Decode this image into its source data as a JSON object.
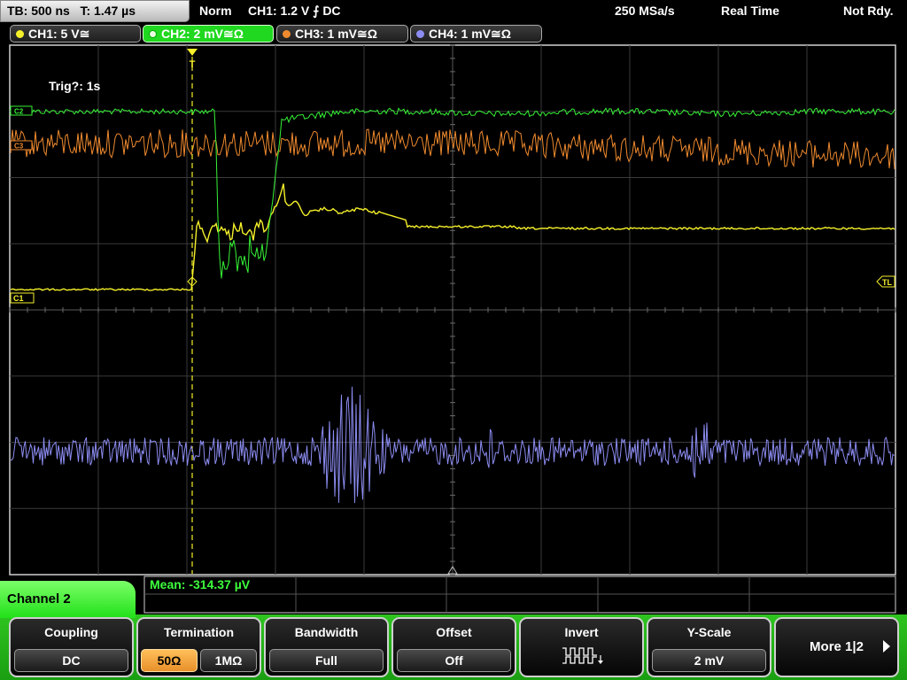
{
  "top_bar": {
    "timebase": "TB: 500 ns",
    "trigger_time": "T: 1.47 µs",
    "mode": "Norm",
    "trigger_setting": "CH1: 1.2 V ⨍ DC",
    "sample_rate": "250 MSa/s",
    "acq_mode": "Real Time",
    "status": "Not Rdy."
  },
  "channel_tabs": [
    {
      "label": "CH1: 5 V≅",
      "color": "#f5f02a",
      "active": false
    },
    {
      "label": "CH2: 2 mV≅Ω",
      "color": "#36f236",
      "active": true
    },
    {
      "label": "CH3: 1 mV≅Ω",
      "color": "#f08a2e",
      "active": false
    },
    {
      "label": "CH4: 1 mV≅Ω",
      "color": "#8c8cf2",
      "active": false
    }
  ],
  "screen": {
    "trigger_status": "Trig?: 1s",
    "markers": {
      "ch2": "C2",
      "ch3": "C3",
      "ch1": "C1",
      "trigger_level": "TL",
      "trigger_pos": "T"
    }
  },
  "measurement": {
    "label": "Mean: -314.37 µV"
  },
  "channel_indicator": "Channel 2",
  "softkeys": {
    "coupling": {
      "title": "Coupling",
      "value": "DC"
    },
    "termination": {
      "title": "Termination",
      "option1": "50Ω",
      "option2": "1MΩ",
      "selected": "50Ω"
    },
    "bandwidth": {
      "title": "Bandwidth",
      "value": "Full"
    },
    "offset": {
      "title": "Offset",
      "value": "Off"
    },
    "invert": {
      "title": "Invert",
      "icon": "invert-waveform-icon"
    },
    "yscale": {
      "title": "Y-Scale",
      "value": "2 mV"
    },
    "more": {
      "label": "More 1|2"
    }
  },
  "colors": {
    "ch1": "#f5f02a",
    "ch2": "#36f236",
    "ch3": "#f08a2e",
    "ch4": "#8c8cf2",
    "active_accent": "#22e01a"
  }
}
